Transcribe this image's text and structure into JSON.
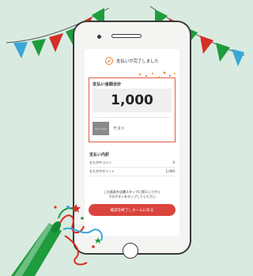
{
  "colors": {
    "background": "#d9ebe0",
    "accent_red": "#d9443c",
    "card_border": "#e05a4a",
    "check_orange": "#e8843f",
    "bunting_green": "#1e9c3e",
    "bunting_blue": "#3aa7d8",
    "bunting_red": "#d62e28"
  },
  "header": {
    "done_icon": "check-circle-icon",
    "done_text": "支払いが完了しました"
  },
  "card": {
    "title": "支払い金額合計",
    "amount": "1,000",
    "thumbnail_text": "No image",
    "item_name": "テスト"
  },
  "breakdown": {
    "title": "支払い内訳",
    "rows": [
      {
        "label": "せたがやコイン",
        "value": "0"
      },
      {
        "label": "せたがやポイント",
        "value": "1,000"
      }
    ]
  },
  "notice": {
    "line1": "この画面を店舗スタッフに提示してから",
    "line2": "下のボタンをタップしてください"
  },
  "close_button": {
    "label": "確認を終了しホームに戻る"
  },
  "decorations": {
    "bunting": "party-bunting-icon",
    "party_horn": "party-horn-icon"
  }
}
